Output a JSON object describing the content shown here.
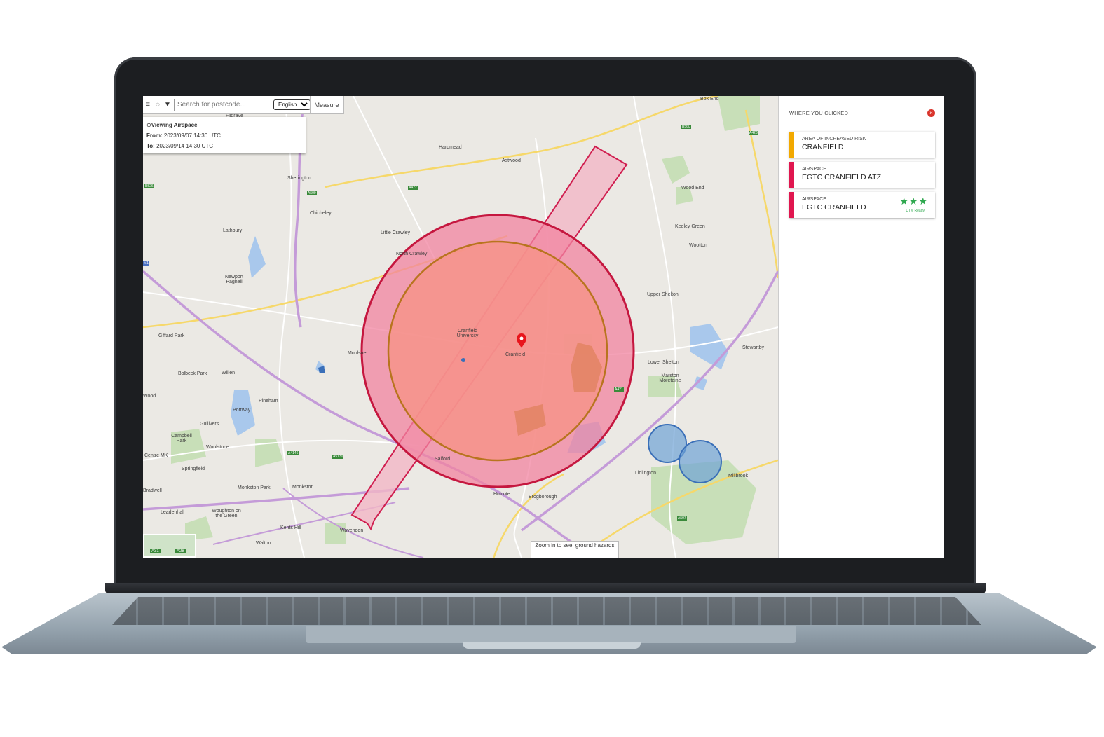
{
  "toolbar": {
    "search_placeholder": "Search for postcode...",
    "language": "English",
    "measure_label": "Measure"
  },
  "viewing": {
    "title": "Viewing Airspace",
    "from_label": "From:",
    "from_value": "2023/09/07 14:30 UTC",
    "to_label": "To:",
    "to_value": "2023/09/14 14:30 UTC"
  },
  "zoom_note": "Zoom in to see: ground hazards",
  "panel": {
    "header": "WHERE YOU CLICKED",
    "items": [
      {
        "type": "AREA OF INCREASED RISK",
        "name": "CRANFIELD",
        "color": "#f2a900"
      },
      {
        "type": "AIRSPACE",
        "name": "EGTC CRANFIELD ATZ",
        "color": "#e0164f"
      },
      {
        "type": "AIRSPACE",
        "name": "EGTC CRANFIELD",
        "color": "#e0164f",
        "stars": "★★★",
        "badge": "UTM Ready"
      }
    ]
  },
  "map": {
    "places": {
      "box_end": "Box End",
      "filgrave": "Filgrave",
      "hardmead": "Hardmead",
      "astwood": "Astwood",
      "sherington": "Sherington",
      "chicheley": "Chicheley",
      "lathbury": "Lathbury",
      "little_crawley": "Little Crawley",
      "north_crawley": "North Crawley",
      "newport_pagnell": "Newport Pagnell",
      "wood_end": "Wood End",
      "keeley_green": "Keeley Green",
      "wootton": "Wootton",
      "upper_shelton": "Upper Shelton",
      "cranfield_university": "Cranfield University",
      "cranfield": "Cranfield",
      "giffard_park": "Giffard Park",
      "moulsoe": "Moulsoe",
      "bolbeck_park": "Bolbeck Park",
      "willen": "Willen",
      "stewartby": "Stewartby",
      "lower_shelton": "Lower Shelton",
      "marston_moretaine": "Marston Moretaine",
      "pineham": "Pineham",
      "gullivers": "Gullivers",
      "campbell_park": "Campbell Park",
      "woolstone": "Woolstone",
      "springfield": "Springfield",
      "salford": "Salford",
      "lidlington": "Lidlington",
      "millbrook": "Millbrook",
      "monkston": "Monkston",
      "monkston_park": "Monkston Park",
      "hulcote": "Hulcote",
      "brogborough": "Brogborough",
      "leadenhall": "Leadenhall",
      "woughton": "Woughton on the Green",
      "kents_hill": "Kents Hill",
      "walton": "Walton",
      "wavendon": "Wavendon",
      "portway": "Portway",
      "centre_mk": "Centre MK",
      "bradwell": "Bradwell",
      "wood_left": "Wood"
    },
    "roads": {
      "a422": "A422",
      "m1": "M1",
      "a509": "A509",
      "a421": "A421",
      "a428": "A428",
      "b560": "B560",
      "b526": "B526",
      "a5130": "A5130",
      "a4146": "A4146",
      "a507": "A507"
    },
    "minimap_labels": [
      "A31",
      "A28"
    ]
  }
}
